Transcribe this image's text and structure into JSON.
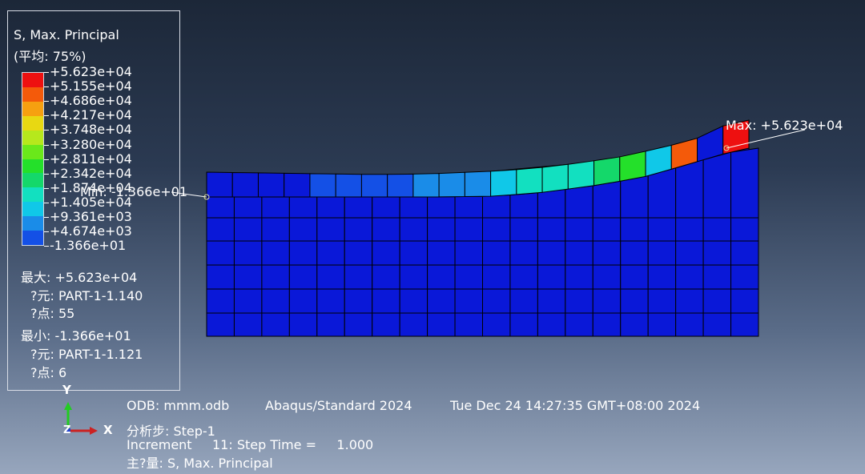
{
  "legend": {
    "title": "S, Max. Principal",
    "subtitle": "(平均: 75%)",
    "levels": [
      {
        "label": "+5.623e+04",
        "color": "#ee1010"
      },
      {
        "label": "+5.155e+04",
        "color": "#f45a0a"
      },
      {
        "label": "+4.686e+04",
        "color": "#f6a010"
      },
      {
        "label": "+4.217e+04",
        "color": "#e8d812"
      },
      {
        "label": "+3.748e+04",
        "color": "#b6e81c"
      },
      {
        "label": "+3.280e+04",
        "color": "#6ae81a"
      },
      {
        "label": "+2.811e+04",
        "color": "#24e02a"
      },
      {
        "label": "+2.342e+04",
        "color": "#14d86a"
      },
      {
        "label": "+1.874e+04",
        "color": "#12e0c0"
      },
      {
        "label": "+1.405e+04",
        "color": "#10c8e8"
      },
      {
        "label": "+9.361e+03",
        "color": "#1a8ce8"
      },
      {
        "label": "+4.674e+03",
        "color": "#1450e6"
      },
      {
        "label": "-1.366e+01",
        "color": "#0a18d8"
      }
    ],
    "max": {
      "label": "最大: +5.623e+04",
      "element": "?元: PART-1-1.140",
      "node": "?点: 55"
    },
    "min": {
      "label": "最小: -1.366e+01",
      "element": "?元: PART-1-1.121",
      "node": "?点: 6"
    }
  },
  "annotations": {
    "max_label": "Max: +5.623e+04",
    "min_label": "Min: -1.366e+01"
  },
  "triad": {
    "x": "X",
    "y": "Y",
    "z": "Z"
  },
  "footer": {
    "odb": "ODB: mmm.odb",
    "solver": "Abaqus/Standard 2024",
    "timestamp": "Tue Dec 24 14:27:35 GMT+08:00 2024",
    "step": "分析步: Step-1",
    "increment": "Increment     11: Step Time =     1.000",
    "variable": "主?量: S, Max. Principal"
  },
  "colors": {
    "mesh_base": "#0a18d8",
    "mesh_line": "#000000"
  },
  "top_row_colors": [
    "#0a18d8",
    "#0a18d8",
    "#0a18d8",
    "#0a18d8",
    "#1450e6",
    "#1450e6",
    "#1450e6",
    "#1450e6",
    "#1a8ce8",
    "#1a8ce8",
    "#1a8ce8",
    "#10c8e8",
    "#12e0c0",
    "#12e0c0",
    "#12e0c0",
    "#14d86a",
    "#24e02a",
    "#10c8e8",
    "#f45a0a",
    "#0a18d8",
    "#ee1010"
  ]
}
